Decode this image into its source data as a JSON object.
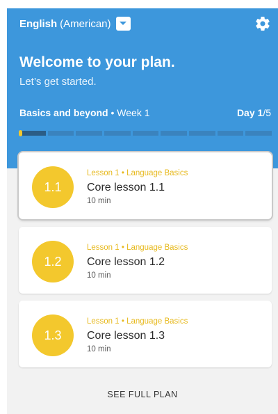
{
  "header": {
    "language_primary": "English",
    "language_secondary": "(American)",
    "welcome": "Welcome to your plan.",
    "subtitle": "Let’s get started.",
    "plan_name": "Basics and beyond",
    "plan_separator": " • ",
    "week": "Week 1",
    "day_label": "Day",
    "day_current": "1",
    "day_total": "/5",
    "progress_segments": 9,
    "progress_active_segment": 1,
    "colors": {
      "header_bg": "#3d97dc",
      "accent_yellow": "#f3c82d",
      "active_segment": "#2b5d86"
    }
  },
  "lessons": [
    {
      "badge": "1.1",
      "meta": "Lesson 1 • Language Basics",
      "title": "Core lesson 1.1",
      "duration": "10 min",
      "selected": true
    },
    {
      "badge": "1.2",
      "meta": "Lesson 1 • Language Basics",
      "title": "Core lesson 1.2",
      "duration": "10 min",
      "selected": false
    },
    {
      "badge": "1.3",
      "meta": "Lesson 1 • Language Basics",
      "title": "Core lesson 1.3",
      "duration": "10 min",
      "selected": false
    }
  ],
  "footer": {
    "see_full_plan": "SEE FULL PLAN"
  },
  "icons": {
    "language_dropdown": "chevron-down-icon",
    "settings": "gear-icon"
  }
}
